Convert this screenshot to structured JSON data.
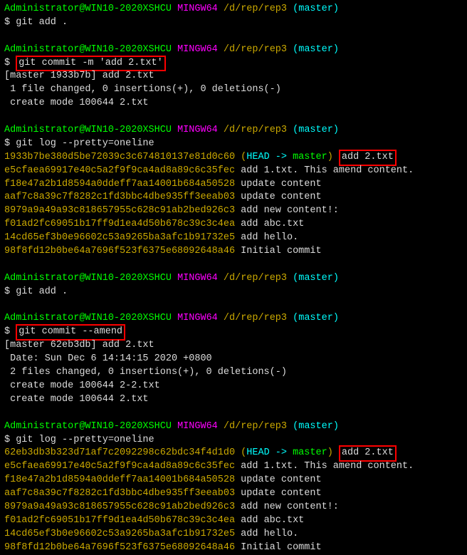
{
  "user": "Administrator@WIN10-2020XSHCU",
  "shell": "MINGW64",
  "path": "/d/rep/rep3",
  "branch": "(master)",
  "prompt1": {
    "cmd": "git add ."
  },
  "prompt2": {
    "cmd": "git commit -m 'add 2.txt'",
    "out1": "[master 1933b7b] add 2.txt",
    "out2": " 1 file changed, 0 insertions(+), 0 deletions(-)",
    "out3": " create mode 100644 2.txt"
  },
  "prompt3": {
    "cmd": "git log --pretty=oneline",
    "log": [
      {
        "hash": "1933b7be380d5be72039c3c674810137e81d0c60",
        "head": " (",
        "ref1": "HEAD -> ",
        "ref2": "master",
        "close": ")",
        "msg": " add 2.txt",
        "boxed": true
      },
      {
        "hash": "e5cfaea69917e40c5a2f9f9ca4ad8a89c6c35fec",
        "msg": " add 1.txt. This amend content."
      },
      {
        "hash": "f18e47a2b1d8594a0ddeff7aa14001b684a50528",
        "msg": " update content"
      },
      {
        "hash": "aaf7c8a39c7f8282c1fd3bbc4dbe935ff3eeab03",
        "msg": " update content"
      },
      {
        "hash": "8979a9a49a93c818657955c628c91ab2bed926c3",
        "msg": " add new content!:"
      },
      {
        "hash": "f01ad2fc69051b17ff9d1ea4d50b678c39c3c4ea",
        "msg": " add abc.txt"
      },
      {
        "hash": "14cd65ef3b0e96602c53a9265ba3afc1b91732e5",
        "msg": " add hello."
      },
      {
        "hash": "98f8fd12b0be64a7696f523f6375e68092648a46",
        "msg": " Initial commit"
      }
    ]
  },
  "prompt4": {
    "cmd": "git add ."
  },
  "prompt5": {
    "cmd": "git commit --amend",
    "out1": "[master 62eb3db] add 2.txt",
    "out2": " Date: Sun Dec 6 14:14:15 2020 +0800",
    "out3": " 2 files changed, 0 insertions(+), 0 deletions(-)",
    "out4": " create mode 100644 2-2.txt",
    "out5": " create mode 100644 2.txt"
  },
  "prompt6": {
    "cmd": "git log --pretty=oneline",
    "log": [
      {
        "hash": "62eb3db3b323d71af7c2092298c62bdc34f4d1d0",
        "head": " (",
        "ref1": "HEAD -> ",
        "ref2": "master",
        "close": ")",
        "msg": " add 2.txt",
        "boxed": true
      },
      {
        "hash": "e5cfaea69917e40c5a2f9f9ca4ad8a89c6c35fec",
        "msg": " add 1.txt. This amend content."
      },
      {
        "hash": "f18e47a2b1d8594a0ddeff7aa14001b684a50528",
        "msg": " update content"
      },
      {
        "hash": "aaf7c8a39c7f8282c1fd3bbc4dbe935ff3eeab03",
        "msg": " update content"
      },
      {
        "hash": "8979a9a49a93c818657955c628c91ab2bed926c3",
        "msg": " add new content!:"
      },
      {
        "hash": "f01ad2fc69051b17ff9d1ea4d50b678c39c3c4ea",
        "msg": " add abc.txt"
      },
      {
        "hash": "14cd65ef3b0e96602c53a9265ba3afc1b91732e5",
        "msg": " add hello."
      },
      {
        "hash": "98f8fd12b0be64a7696f523f6375e68092648a46",
        "msg": " Initial commit"
      }
    ]
  },
  "dollar": "$ "
}
